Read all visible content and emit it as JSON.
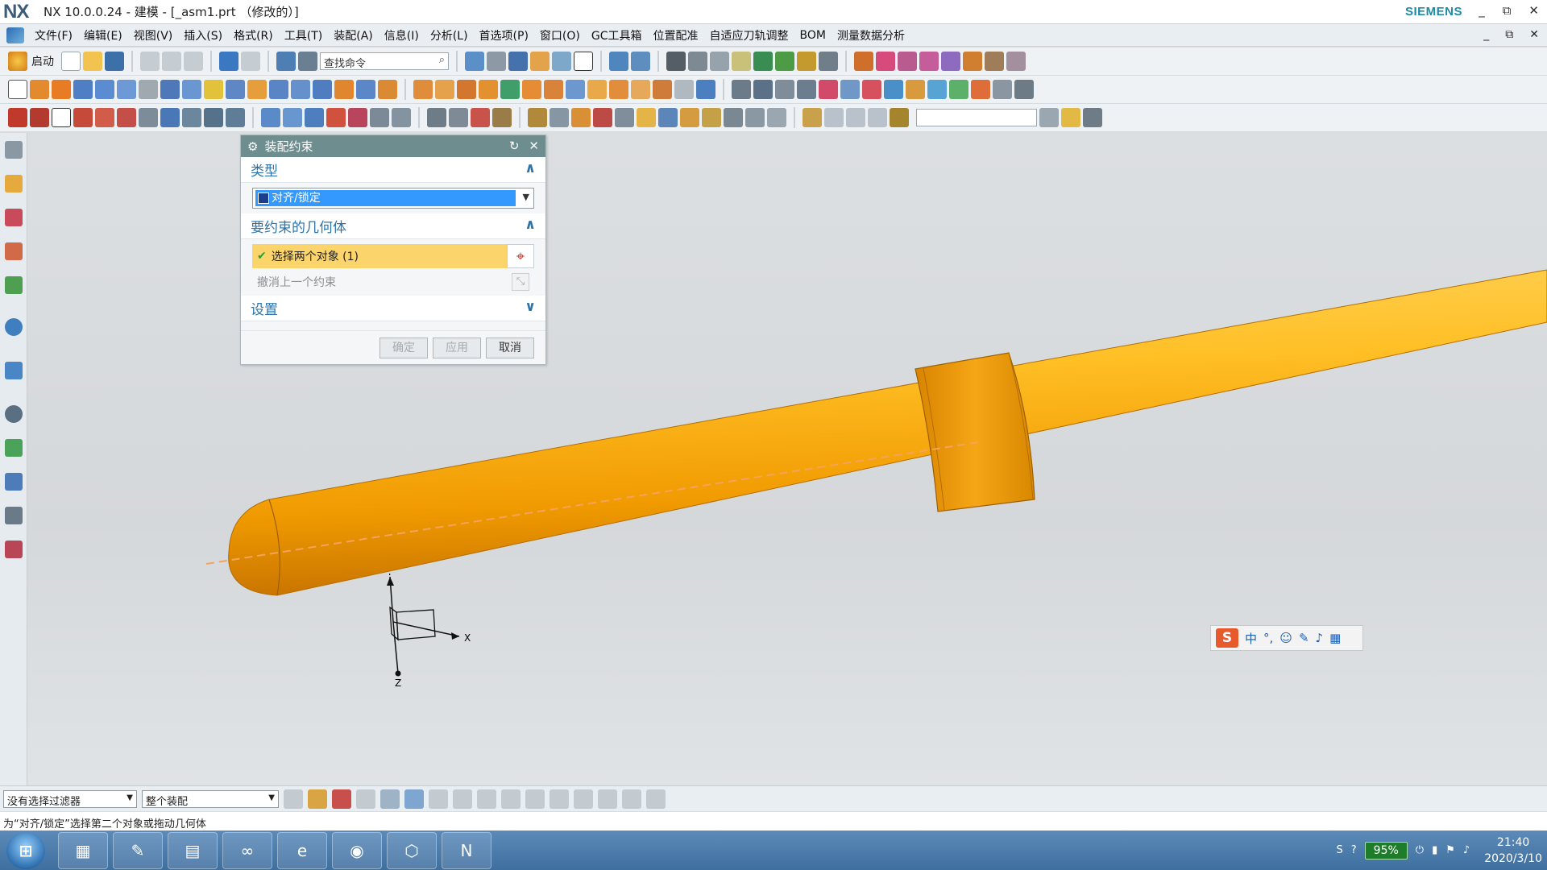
{
  "window": {
    "logo": "NX",
    "title": "NX 10.0.0.24 - 建模 - [_asm1.prt （修改的）]",
    "brand": "SIEMENS",
    "controls": [
      "_",
      "⧉",
      "✕"
    ]
  },
  "menu": {
    "items": [
      "文件(F)",
      "编辑(E)",
      "视图(V)",
      "插入(S)",
      "格式(R)",
      "工具(T)",
      "装配(A)",
      "信息(I)",
      "分析(L)",
      "首选项(P)",
      "窗口(O)",
      "GC工具箱",
      "位置配准",
      "自适应刀轨调整",
      "BOM",
      "测量数据分析"
    ],
    "right_controls": [
      "_",
      "⧉",
      "✕"
    ]
  },
  "toolbar": {
    "start_label": "启动",
    "find_placeholder": "查找命令"
  },
  "dialog": {
    "title": "装配约束",
    "type_section": "类型",
    "type_value": "对齐/锁定",
    "geometry_section": "要约束的几何体",
    "select_label": "选择两个对象 (1)",
    "undo_label": "撤消上一个约束",
    "settings_section": "设置",
    "ok": "确定",
    "apply": "应用",
    "cancel": "取消"
  },
  "coord": {
    "x_label": "X",
    "y_label": "Y",
    "z_label": "Z"
  },
  "ime": {
    "logo": "S",
    "lang": "中"
  },
  "selection_bar": {
    "filter": "没有选择过滤器",
    "scope": "整个装配"
  },
  "status": {
    "text": "为“对齐/锁定”选择第二个对象或拖动几何体"
  },
  "taskbar": {
    "battery": "95%",
    "time": "21:40",
    "date": "2020/3/10"
  },
  "colors": {
    "part": "#f5a91c",
    "dialog_title": "#6d8d8f",
    "selection": "#fbd56b",
    "accent": "#2c73a8"
  }
}
